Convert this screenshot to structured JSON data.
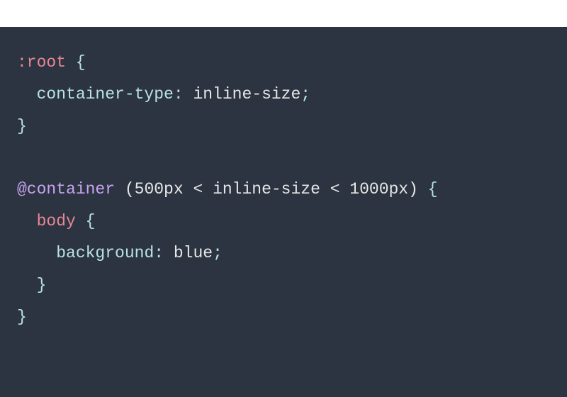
{
  "code": {
    "line1": {
      "selector": ":root",
      "brace_open": " {"
    },
    "line2": {
      "indent": "  ",
      "prop": "container-type",
      "colon": ": ",
      "value": "inline-size",
      "semi": ";"
    },
    "line3": {
      "brace_close": "}"
    },
    "line4": {
      "blank": " "
    },
    "line5": {
      "atrule": "@container",
      "space": " ",
      "condition": "(500px < inline-size < 1000px)",
      "brace_open": " {"
    },
    "line6": {
      "indent": "  ",
      "selector": "body",
      "brace_open": " {"
    },
    "line7": {
      "indent": "    ",
      "prop": "background",
      "colon": ": ",
      "value": "blue",
      "semi": ";"
    },
    "line8": {
      "indent": "  ",
      "brace_close": "}"
    },
    "line9": {
      "brace_close": "}"
    }
  }
}
